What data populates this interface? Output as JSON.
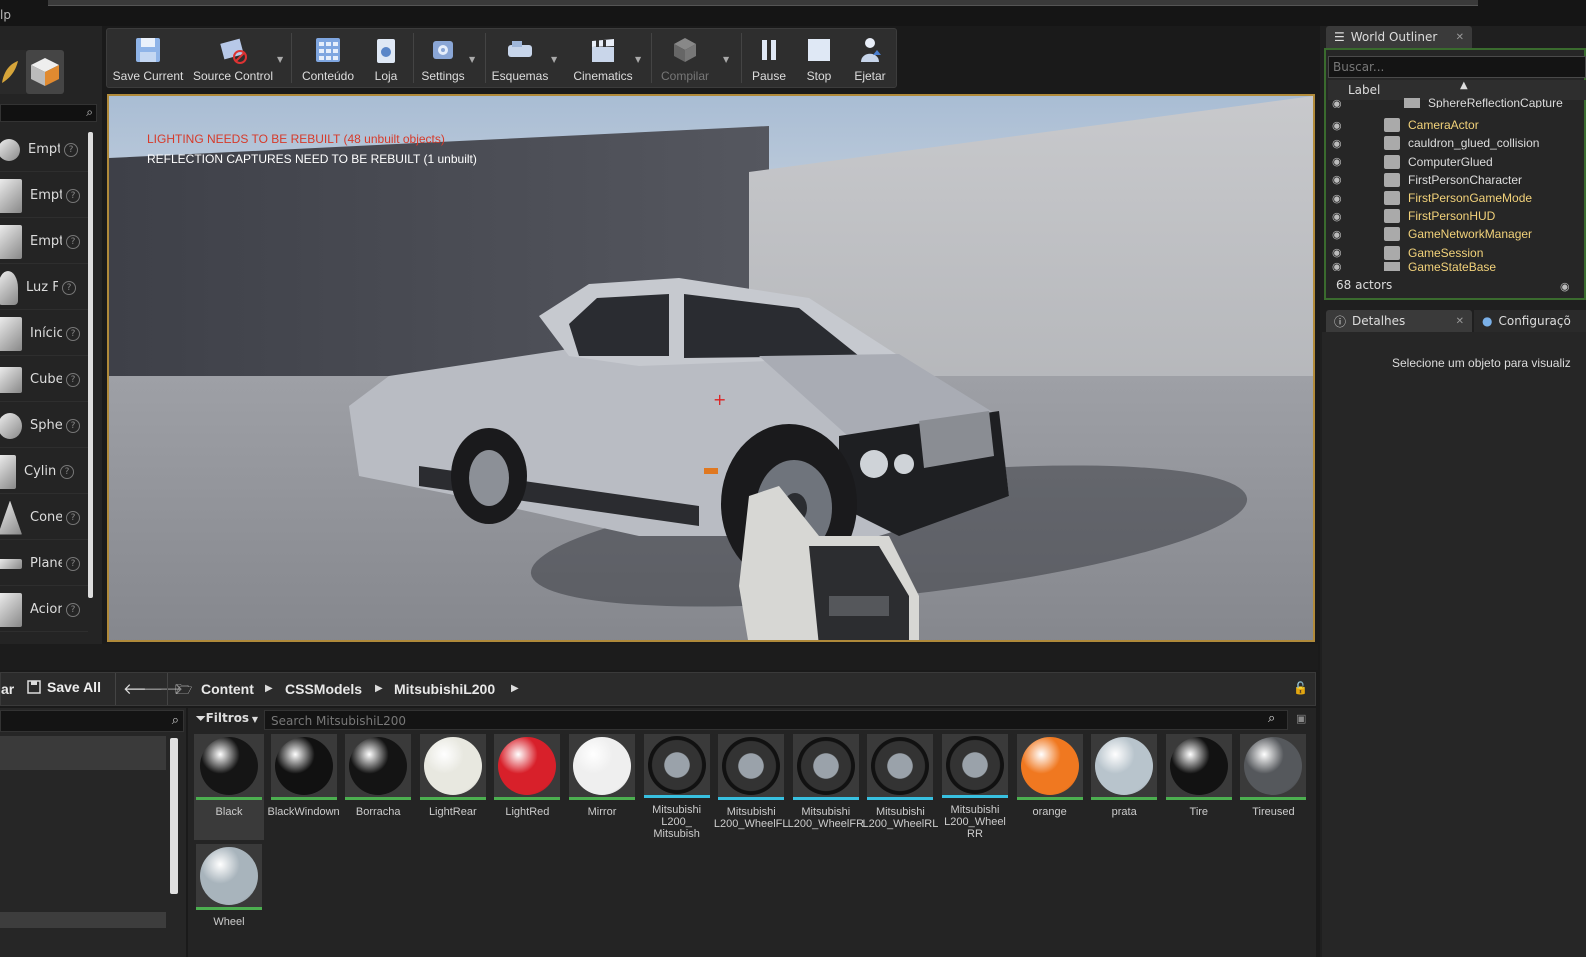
{
  "menubar": {
    "help_fragment": "lp"
  },
  "modes": {
    "place_items": [
      {
        "label": "Empt"
      },
      {
        "label": "Empt"
      },
      {
        "label": "Empt"
      },
      {
        "label": "Luz F"
      },
      {
        "label": "Inícic"
      },
      {
        "label": "Cube"
      },
      {
        "label": "Sphe"
      },
      {
        "label": "Cylin"
      },
      {
        "label": "Cone"
      },
      {
        "label": "Plane"
      },
      {
        "label": "Acior"
      }
    ],
    "help_glyph": "?"
  },
  "toolbar": {
    "buttons": [
      {
        "label": "Save Current",
        "icon": "floppy-disk-icon"
      },
      {
        "label": "Source Control",
        "icon": "source-control-icon"
      },
      {
        "label": "Conteúdo",
        "icon": "content-grid-icon"
      },
      {
        "label": "Loja",
        "icon": "marketplace-icon"
      },
      {
        "label": "Settings",
        "icon": "settings-gear-icon"
      },
      {
        "label": "Esquemas",
        "icon": "blueprint-icon"
      },
      {
        "label": "Cinematics",
        "icon": "clapperboard-icon"
      },
      {
        "label": "Compilar",
        "icon": "build-icon"
      },
      {
        "label": "Pause",
        "icon": "pause-icon"
      },
      {
        "label": "Stop",
        "icon": "stop-icon"
      },
      {
        "label": "Ejetar",
        "icon": "eject-icon"
      }
    ]
  },
  "viewport": {
    "warning_lighting": "LIGHTING NEEDS TO BE REBUILT (48 unbuilt objects)",
    "warning_reflection": "REFLECTION CAPTURES NEED TO BE REBUILT (1 unbuilt)",
    "warning_color": "#d63a2a"
  },
  "content_browser": {
    "save_fragment": "ar",
    "save_all": "Save All",
    "breadcrumb": [
      "Content",
      "CSSModels",
      "MitsubishiL200"
    ],
    "filter_label": "Filtros",
    "search_placeholder": "Search MitsubishiL200",
    "assets": [
      {
        "name": "Black",
        "kind": "material",
        "color": "#151515"
      },
      {
        "name": "BlackWindown",
        "kind": "material",
        "color": "#111111"
      },
      {
        "name": "Borracha",
        "kind": "material",
        "color": "#141414"
      },
      {
        "name": "LightRear",
        "kind": "material",
        "color": "#e8e8e0"
      },
      {
        "name": "LightRed",
        "kind": "material",
        "color": "#d8202a"
      },
      {
        "name": "Mirror",
        "kind": "material",
        "color": "#efefef"
      },
      {
        "name": "Mitsubishi L200_ Mitsubish",
        "kind": "mesh",
        "color": "#9aa"
      },
      {
        "name": "Mitsubishi L200_WheelFL",
        "kind": "mesh",
        "color": "#222"
      },
      {
        "name": "Mitsubishi L200_WheelFR",
        "kind": "mesh",
        "color": "#222"
      },
      {
        "name": "Mitsubishi L200_WheelRL",
        "kind": "mesh",
        "color": "#222"
      },
      {
        "name": "Mitsubishi L200_Wheel RR",
        "kind": "mesh",
        "color": "#222"
      },
      {
        "name": "orange",
        "kind": "material",
        "color": "#f07820"
      },
      {
        "name": "prata",
        "kind": "material",
        "color": "#b8c4cc"
      },
      {
        "name": "Tire",
        "kind": "material",
        "color": "#121212"
      },
      {
        "name": "Tireused",
        "kind": "material",
        "color": "#55585c"
      },
      {
        "name": "Wheel",
        "kind": "material",
        "color": "#a8b4bc"
      }
    ]
  },
  "world_outliner": {
    "tab_label": "World Outliner",
    "search_placeholder": "Buscar...",
    "column_label": "Label",
    "rows": [
      {
        "label": "SphereReflectionCapture",
        "color": "#dddddd"
      },
      {
        "label": "CameraActor",
        "color": "#f2d27a"
      },
      {
        "label": "cauldron_glued_collision",
        "color": "#dddddd"
      },
      {
        "label": "ComputerGlued",
        "color": "#dddddd"
      },
      {
        "label": "FirstPersonCharacter",
        "color": "#dddddd"
      },
      {
        "label": "FirstPersonGameMode",
        "color": "#f2d27a"
      },
      {
        "label": "FirstPersonHUD",
        "color": "#f2d27a"
      },
      {
        "label": "GameNetworkManager",
        "color": "#f2d27a"
      },
      {
        "label": "GameSession",
        "color": "#f2d27a"
      },
      {
        "label": "GameStateBase",
        "color": "#f2d27a"
      }
    ],
    "count": "68 actors"
  },
  "details": {
    "tab_label": "Detalhes",
    "config_tab_label": "Configuraçõ",
    "empty_message": "Selecione um objeto para visualiz"
  }
}
